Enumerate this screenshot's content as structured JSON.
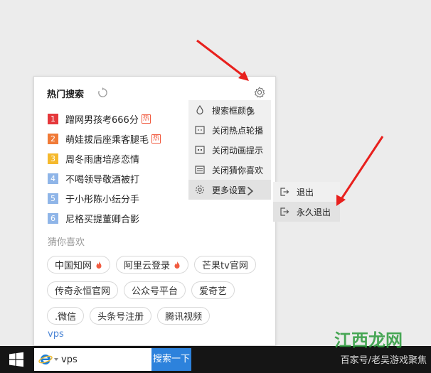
{
  "hot_search": {
    "title": "热门搜索",
    "items": [
      {
        "rank": "1",
        "text": "蹭网男孩考666分",
        "badge": "热",
        "color": "#e5383b"
      },
      {
        "rank": "2",
        "text": "萌娃拔后座乘客腿毛",
        "badge": "热",
        "color": "#f07a37"
      },
      {
        "rank": "3",
        "text": "周冬雨唐培彦恋情",
        "badge": "",
        "color": "#f5b92d"
      },
      {
        "rank": "4",
        "text": "不喝领导敬酒被打",
        "badge": "",
        "color": "#8fb5e8"
      },
      {
        "rank": "5",
        "text": "于小彤陈小纭分手",
        "badge": "",
        "color": "#8fb5e8"
      },
      {
        "rank": "6",
        "text": "尼格买提董卿合影",
        "badge": "",
        "color": "#8fb5e8"
      }
    ]
  },
  "guess": {
    "title": "猜你喜欢",
    "rows": [
      [
        {
          "label": "中国知网",
          "hot": true
        },
        {
          "label": "阿里云登录",
          "hot": true
        },
        {
          "label": "芒果tv官网",
          "hot": false
        }
      ],
      [
        {
          "label": "传奇永恒官网",
          "hot": false
        },
        {
          "label": "公众号平台",
          "hot": false
        },
        {
          "label": "爱奇艺",
          "hot": false
        }
      ],
      [
        {
          "label": ".微信",
          "hot": false
        },
        {
          "label": "头条号注册",
          "hot": false
        },
        {
          "label": "腾讯视频",
          "hot": false
        }
      ]
    ]
  },
  "query_preview": "vps",
  "settings_menu": [
    {
      "label": "搜索框颜色",
      "icon": "drop-icon",
      "has_submenu": true
    },
    {
      "label": "关闭热点轮播",
      "icon": "carousel-icon",
      "has_submenu": false
    },
    {
      "label": "关闭动画提示",
      "icon": "animation-icon",
      "has_submenu": false
    },
    {
      "label": "关闭猜你喜欢",
      "icon": "list-icon",
      "has_submenu": false
    },
    {
      "label": "更多设置",
      "icon": "gear-icon",
      "has_submenu": true
    }
  ],
  "submenu": [
    {
      "label": "退出",
      "icon": "exit-icon"
    },
    {
      "label": "永久退出",
      "icon": "exit-icon"
    }
  ],
  "taskbar": {
    "search_value": "vps",
    "search_button": "搜索一下",
    "watermark": "百家号/老吴游戏聚焦",
    "watermark_logo": "江西龙网"
  },
  "colors": {
    "accent": "#2d82dc",
    "arrow": "#e8201d"
  }
}
